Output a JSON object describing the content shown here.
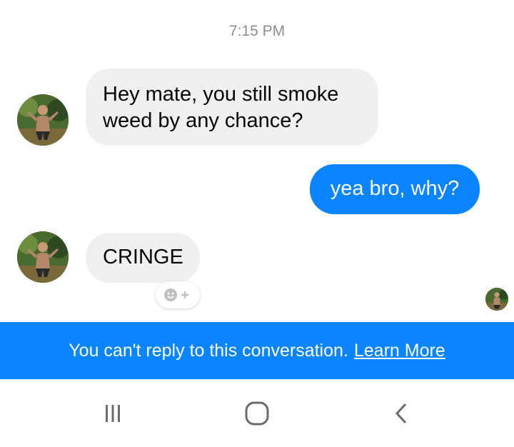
{
  "conversation": {
    "timestamp": "7:15 PM",
    "messages": [
      {
        "direction": "incoming",
        "text": "Hey mate, you still smoke weed by any chance?"
      },
      {
        "direction": "outgoing",
        "text": "yea bro, why?"
      },
      {
        "direction": "incoming",
        "text": "CRINGE"
      }
    ],
    "reaction_button_icon": "add-reaction-icon",
    "seen_indicator": "avatar"
  },
  "banner": {
    "text": "You can't reply to this conversation.",
    "link": "Learn More"
  },
  "navbar": {
    "items": [
      "recent-apps-icon",
      "home-icon",
      "back-icon"
    ]
  },
  "colors": {
    "accent": "#0a84ff",
    "incoming_bubble": "#f0f0f0",
    "timestamp": "#8a8d91"
  }
}
